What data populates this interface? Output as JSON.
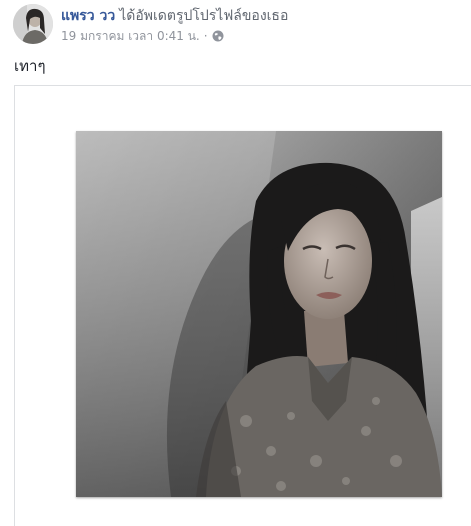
{
  "post": {
    "author_name": "แพรว วว",
    "action_text": "ได้อัพเดตรูปโปรไฟล์ของเธอ",
    "timestamp": "19 มกราคม เวลา 0:41 น.",
    "separator": "·",
    "audience_icon": "globe-icon",
    "caption": "เทาๆ"
  },
  "colors": {
    "author_link": "#365899",
    "meta_text": "#90949c",
    "body_text": "#1d2129",
    "frame_border": "#dddfe2"
  }
}
